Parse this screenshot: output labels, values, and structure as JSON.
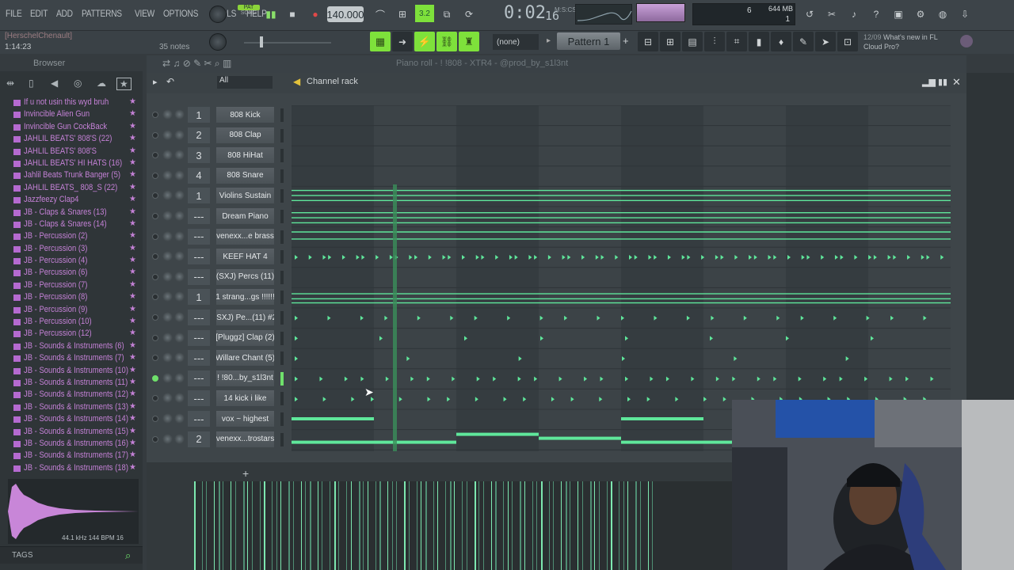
{
  "menu": [
    "FILE",
    "EDIT",
    "ADD",
    "PATTERNS",
    "VIEW",
    "OPTIONS",
    "TOOLS",
    "HELP"
  ],
  "transport": {
    "pat_label": "PAT",
    "song_label": "SONG",
    "tempo": "140.000",
    "time": "0:02",
    "time_ticks": "16",
    "time_unit": "M:S:CS",
    "cpu_value": "6",
    "memory": "644 MB",
    "poly": "1",
    "snap_value": "3.2"
  },
  "hint": {
    "user": "[HerschelChenault]",
    "position": "1:14:23",
    "notes": "35 notes"
  },
  "toolbar2": {
    "pattern_none": "(none)",
    "pattern_name": "Pattern 1",
    "news_date": "12/09",
    "news_text": "What's new in FL",
    "news_text2": "Cloud Pro?"
  },
  "browser": {
    "title": "Browser",
    "items": [
      "If u not usin this wyd bruh",
      "Invincible Alien Gun",
      "Invincible Gun CockBack",
      "JAHLIL BEATS' 808'S (22)",
      "JAHLIL BEATS' 808'S",
      "JAHLIL BEATS' HI HATS (16)",
      "Jahlil Beats Trunk Banger (5)",
      "JAHLIL BEATS_ 808_S (22)",
      "Jazzfeezy Clap4",
      "JB - Claps & Snares (13)",
      "JB - Claps & Snares (14)",
      "JB - Percussion (2)",
      "JB - Percussion (3)",
      "JB - Percussion (4)",
      "JB - Percussion (6)",
      "JB - Percussion (7)",
      "JB - Percussion (8)",
      "JB - Percussion (9)",
      "JB - Percussion (10)",
      "JB - Percussion (12)",
      "JB - Sounds & Instruments (6)",
      "JB - Sounds & Instruments (7)",
      "JB - Sounds & Instruments (10)",
      "JB - Sounds & Instruments (11)",
      "JB - Sounds & Instruments (12)",
      "JB - Sounds & Instruments (13)",
      "JB - Sounds & Instruments (14)",
      "JB - Sounds & Instruments (15)",
      "JB - Sounds & Instruments (16)",
      "JB - Sounds & Instruments (17)",
      "JB - Sounds & Instruments (18)"
    ],
    "sample_info": "44.1 kHz 144 BPM 16",
    "tags_label": "TAGS"
  },
  "channel_rack": {
    "piano_roll_title": "Piano roll - ! !808 - XTR4 - @prod_by_s1l3nt",
    "title": "Channel rack",
    "filter": "All",
    "channels": [
      {
        "num": "1",
        "name": "808 Kick",
        "led": false,
        "sel": false
      },
      {
        "num": "2",
        "name": "808 Clap",
        "led": false,
        "sel": false
      },
      {
        "num": "3",
        "name": "808 HiHat",
        "led": false,
        "sel": false
      },
      {
        "num": "4",
        "name": "808 Snare",
        "led": false,
        "sel": false
      },
      {
        "num": "1",
        "name": "Violins Sustain",
        "led": false,
        "sel": false
      },
      {
        "num": "---",
        "name": "Dream Piano",
        "led": false,
        "sel": false
      },
      {
        "num": "---",
        "name": "venexx...e brass",
        "led": false,
        "sel": false
      },
      {
        "num": "---",
        "name": "KEEF HAT 4",
        "led": false,
        "sel": false
      },
      {
        "num": "---",
        "name": "(SXJ) Percs (11)",
        "led": false,
        "sel": false
      },
      {
        "num": "1",
        "name": "1 strang...gs !!!!!!",
        "led": false,
        "sel": false
      },
      {
        "num": "---",
        "name": "(SXJ) Pe...(11) #2",
        "led": false,
        "sel": false
      },
      {
        "num": "---",
        "name": "[Pluggz] Clap (2)",
        "led": false,
        "sel": false
      },
      {
        "num": "---",
        "name": "Willare Chant (5)",
        "led": false,
        "sel": false
      },
      {
        "num": "---",
        "name": "! !80...by_s1l3nt",
        "led": true,
        "sel": true
      },
      {
        "num": "---",
        "name": "14 kick i like",
        "led": false,
        "sel": false
      },
      {
        "num": "---",
        "name": "vox ~ highest",
        "led": false,
        "sel": false
      },
      {
        "num": "2",
        "name": "venexx...trostars",
        "led": false,
        "sel": false
      }
    ]
  },
  "colors": {
    "accent": "#6fe06b",
    "browser_item": "#c481d6",
    "note": "#5fe79b"
  }
}
